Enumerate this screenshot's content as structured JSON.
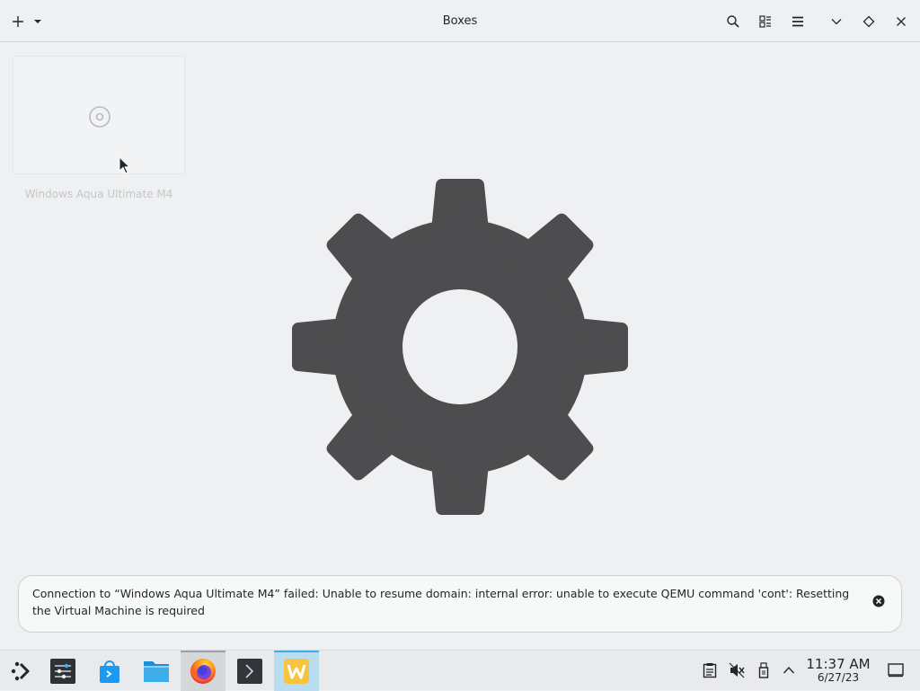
{
  "window": {
    "title": "Boxes",
    "icons": {
      "add": "plus-icon",
      "add_menu": "chevron-down-icon",
      "search": "search-icon",
      "view": "list-view-icon",
      "menu": "hamburger-menu-icon",
      "minimize": "minimize-icon",
      "maximize": "maximize-icon",
      "close": "close-icon"
    }
  },
  "boxes": [
    {
      "name": "Windows Aqua Ultimate M4",
      "icon": "disc-icon"
    }
  ],
  "background_icon": "gear-icon",
  "notification": {
    "message": "Connection to “Windows Aqua Ultimate M4” failed: Unable to resume domain: internal error: unable to execute QEMU command 'cont': Resetting the Virtual Machine is required",
    "close_icon": "close-circle-icon"
  },
  "taskbar": {
    "launcher_icon": "application-launcher-icon",
    "apps": [
      "system-settings",
      "discover",
      "files",
      "firefox",
      "terminal",
      "boxes"
    ],
    "tray_icons": [
      "clipboard-icon",
      "volume-muted-icon",
      "usb-device-icon",
      "tray-expand-icon"
    ],
    "clock": {
      "time": "11:37 AM",
      "date": "6/27/23"
    },
    "show_desktop_icon": "show-desktop-icon"
  },
  "colors": {
    "accent": "#3daee9",
    "gear": "#4d4d4f",
    "background": "#eff0f1"
  }
}
